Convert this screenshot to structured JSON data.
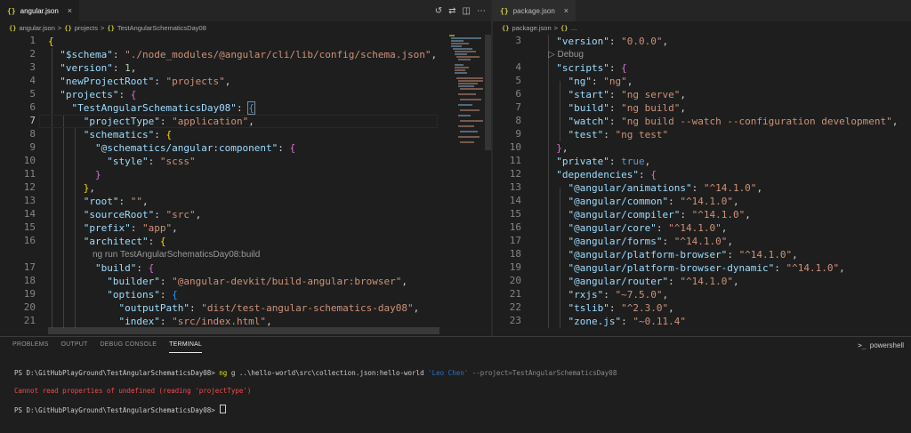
{
  "left_editor": {
    "tab": {
      "icon": "{}",
      "label": "angular.json",
      "close": "×"
    },
    "actions": [
      "history-icon",
      "compare-icon",
      "split-editor-icon",
      "more-actions-icon"
    ],
    "breadcrumb": [
      {
        "icon": "{}",
        "label": "angular.json"
      },
      {
        "sep": ">"
      },
      {
        "icon": "{}",
        "label": "projects"
      },
      {
        "sep": ">"
      },
      {
        "icon": "{}",
        "label": "TestAngularSchematicsDay08"
      }
    ],
    "lines": [
      {
        "n": "1"
      },
      {
        "n": "2"
      },
      {
        "n": "3"
      },
      {
        "n": "4"
      },
      {
        "n": "5"
      },
      {
        "n": "6"
      },
      {
        "n": "7"
      },
      {
        "n": "8"
      },
      {
        "n": "9"
      },
      {
        "n": "10"
      },
      {
        "n": "11"
      },
      {
        "n": "12"
      },
      {
        "n": "13"
      },
      {
        "n": "14"
      },
      {
        "n": "15"
      },
      {
        "n": "16"
      },
      {
        "n": "17"
      },
      {
        "n": "18"
      },
      {
        "n": "19"
      },
      {
        "n": "20"
      },
      {
        "n": "21"
      }
    ],
    "code": {
      "l2_key": "\"$schema\"",
      "l2_val": "\"./node_modules/@angular/cli/lib/config/schema.json\"",
      "l3_key": "\"version\"",
      "l3_val": "1",
      "l4_key": "\"newProjectRoot\"",
      "l4_val": "\"projects\"",
      "l5_key": "\"projects\"",
      "l6_key": "\"TestAngularSchematicsDay08\"",
      "l7_key": "\"projectType\"",
      "l7_val": "\"application\"",
      "l8_key": "\"schematics\"",
      "l9_key": "\"@schematics/angular:component\"",
      "l10_key": "\"style\"",
      "l10_val": "\"scss\"",
      "l13_key": "\"root\"",
      "l13_val": "\"\"",
      "l14_key": "\"sourceRoot\"",
      "l14_val": "\"src\"",
      "l15_key": "\"prefix\"",
      "l15_val": "\"app\"",
      "l16_key": "\"architect\"",
      "codelens": "ng run TestAngularSchematicsDay08:build",
      "l17_key": "\"build\"",
      "l18_key": "\"builder\"",
      "l18_val": "\"@angular-devkit/build-angular:browser\"",
      "l19_key": "\"options\"",
      "l20_key": "\"outputPath\"",
      "l20_val": "\"dist/test-angular-schematics-day08\"",
      "l21_key": "\"index\"",
      "l21_val": "\"src/index.html\""
    }
  },
  "right_editor": {
    "tab": {
      "icon": "{}",
      "label": "package.json",
      "close": "×"
    },
    "breadcrumb": [
      {
        "icon": "{}",
        "label": "package.json"
      },
      {
        "sep": ">"
      },
      {
        "icon": "{}",
        "label": "…"
      }
    ],
    "lines": [
      {
        "n": "3"
      },
      {
        "n": "4"
      },
      {
        "n": "5"
      },
      {
        "n": "6"
      },
      {
        "n": "7"
      },
      {
        "n": "8"
      },
      {
        "n": "9"
      },
      {
        "n": "10"
      },
      {
        "n": "11"
      },
      {
        "n": "12"
      },
      {
        "n": "13"
      },
      {
        "n": "14"
      },
      {
        "n": "15"
      },
      {
        "n": "16"
      },
      {
        "n": "17"
      },
      {
        "n": "18"
      },
      {
        "n": "19"
      },
      {
        "n": "20"
      },
      {
        "n": "21"
      },
      {
        "n": "22"
      },
      {
        "n": "23"
      }
    ],
    "codelens": "▷ Debug",
    "code": {
      "r3_key": "\"version\"",
      "r3_val": "\"0.0.0\"",
      "r4_key": "\"scripts\"",
      "r5_key": "\"ng\"",
      "r5_val": "\"ng\"",
      "r6_key": "\"start\"",
      "r6_val": "\"ng serve\"",
      "r7_key": "\"build\"",
      "r7_val": "\"ng build\"",
      "r8_key": "\"watch\"",
      "r8_val": "\"ng build --watch --configuration development\"",
      "r9_key": "\"test\"",
      "r9_val": "\"ng test\"",
      "r11_key": "\"private\"",
      "r11_val": "true",
      "r12_key": "\"dependencies\"",
      "r13_key": "\"@angular/animations\"",
      "r13_val": "\"^14.1.0\"",
      "r14_key": "\"@angular/common\"",
      "r14_val": "\"^14.1.0\"",
      "r15_key": "\"@angular/compiler\"",
      "r15_val": "\"^14.1.0\"",
      "r16_key": "\"@angular/core\"",
      "r16_val": "\"^14.1.0\"",
      "r17_key": "\"@angular/forms\"",
      "r17_val": "\"^14.1.0\"",
      "r18_key": "\"@angular/platform-browser\"",
      "r18_val": "\"^14.1.0\"",
      "r19_key": "\"@angular/platform-browser-dynamic\"",
      "r19_val": "\"^14.1.0\"",
      "r20_key": "\"@angular/router\"",
      "r20_val": "\"^14.1.0\"",
      "r21_key": "\"rxjs\"",
      "r21_val": "\"~7.5.0\"",
      "r22_key": "\"tslib\"",
      "r22_val": "\"^2.3.0\"",
      "r23_key": "\"zone.js\"",
      "r23_val": "\"~0.11.4\""
    }
  },
  "panel": {
    "tabs": [
      "PROBLEMS",
      "OUTPUT",
      "DEBUG CONSOLE",
      "TERMINAL"
    ],
    "active_tab": "TERMINAL",
    "shell_label": "powershell",
    "terminal": {
      "line1_prompt": "PS D:\\GitHubPlayGround\\TestAngularSchematicsDay08> ",
      "line1_cmd": "ng",
      "line1_args": " g ..\\hello-world\\src\\collection.json:hello-world ",
      "line1_str": "'Leo Chen'",
      "line1_flag": " --project=TestAngularSchematicsDay08",
      "line2_error": "Cannot read properties of undefined (reading 'projectType')",
      "line3_prompt": "PS D:\\GitHubPlayGround\\TestAngularSchematicsDay08> "
    }
  },
  "colors": {
    "background": "#1e1e1e",
    "key": "#9cdcfe",
    "string": "#ce9178",
    "number": "#b5cea8",
    "error": "#f14c4c"
  }
}
